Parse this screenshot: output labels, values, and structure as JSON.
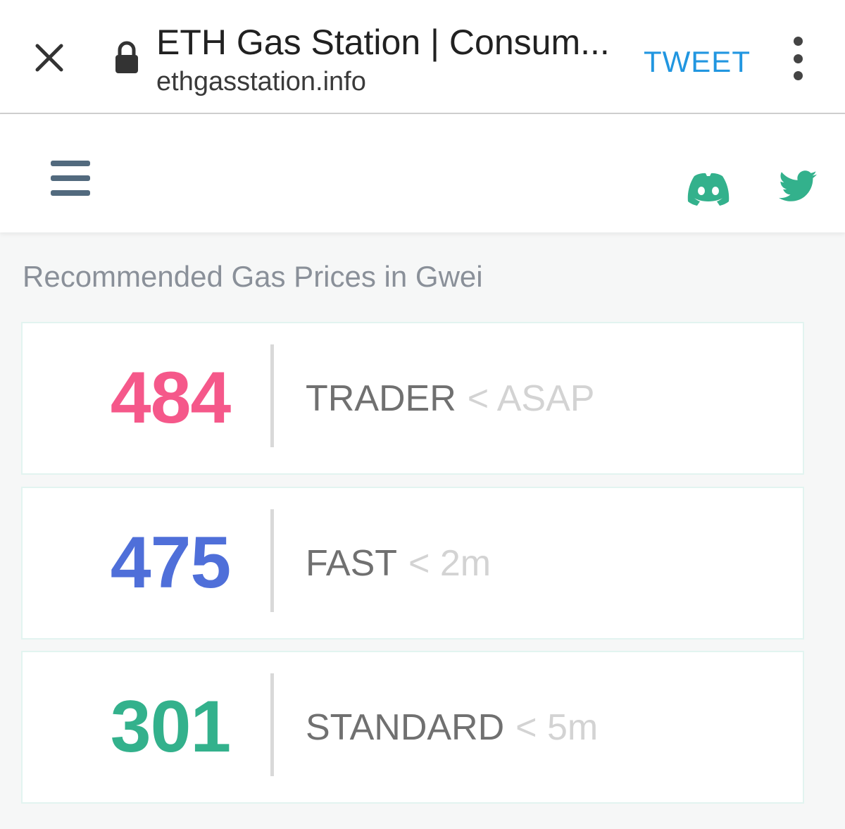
{
  "browser": {
    "title": "ETH Gas Station | Consum...",
    "url": "ethgasstation.info",
    "tweet_label": "TWEET",
    "icons": {
      "close": "close-icon",
      "lock": "lock-icon",
      "more": "more-vert-icon"
    }
  },
  "header": {
    "icons": {
      "menu": "hamburger-menu-icon",
      "discord": "discord-icon",
      "twitter": "twitter-icon"
    },
    "accent_color": "#33b18c",
    "menu_color": "#526a7e"
  },
  "gas": {
    "title": "Recommended Gas Prices in Gwei",
    "tiers": [
      {
        "value": "484",
        "name": "TRADER",
        "time": "< ASAP",
        "color": "#f5588a"
      },
      {
        "value": "475",
        "name": "FAST",
        "time": "< 2m",
        "color": "#4f6fd9"
      },
      {
        "value": "301",
        "name": "STANDARD",
        "time": "< 5m",
        "color": "#33b18c"
      }
    ]
  }
}
